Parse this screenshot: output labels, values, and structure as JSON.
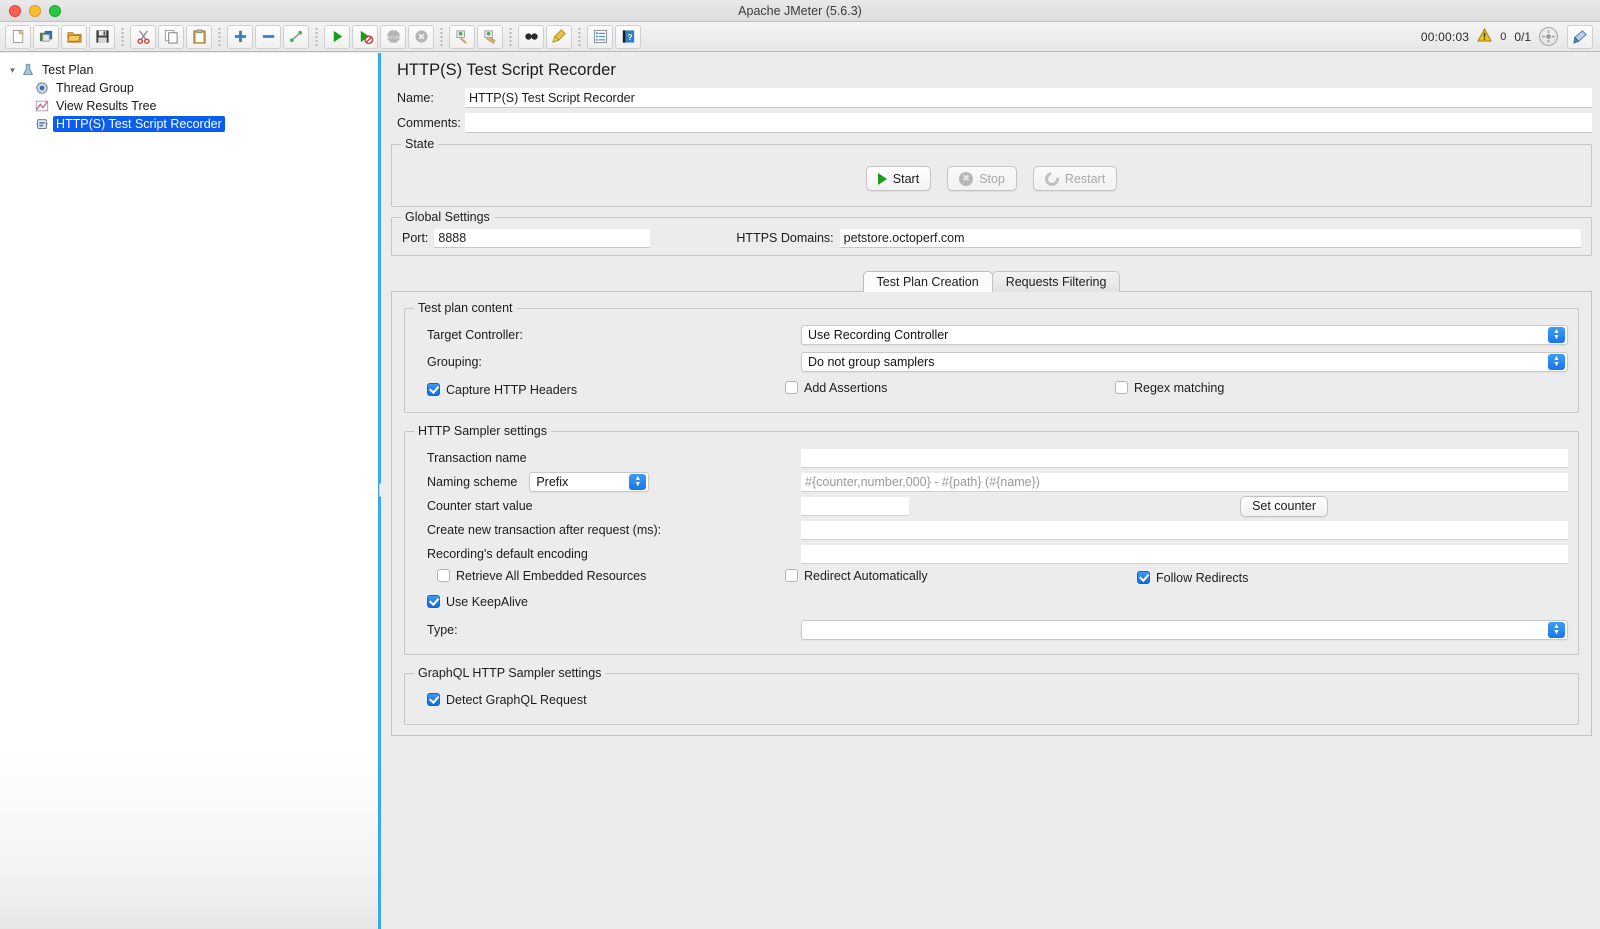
{
  "window": {
    "title": "Apache JMeter (5.6.3)"
  },
  "toolbar": {
    "buttons": [
      {
        "name": "new",
        "glyph": "📄"
      },
      {
        "name": "templates",
        "glyph": "📚"
      },
      {
        "name": "open",
        "glyph": "📂"
      },
      {
        "name": "save",
        "glyph": "💾"
      },
      {
        "name": "cut",
        "glyph": "✂"
      },
      {
        "name": "copy",
        "glyph": "❐"
      },
      {
        "name": "paste",
        "glyph": "📋"
      },
      {
        "name": "expand-all",
        "glyph": "➕"
      },
      {
        "name": "collapse-all",
        "glyph": "➖"
      },
      {
        "name": "toggle",
        "glyph": "↗"
      },
      {
        "name": "start",
        "glyph": "▶"
      },
      {
        "name": "start-no-timers",
        "glyph": "▷"
      },
      {
        "name": "stop",
        "glyph": "⬣"
      },
      {
        "name": "shutdown",
        "glyph": "✖"
      },
      {
        "name": "clear",
        "glyph": "🧹"
      },
      {
        "name": "clear-all",
        "glyph": "🧹"
      },
      {
        "name": "search",
        "glyph": "🔎"
      },
      {
        "name": "reset-search",
        "glyph": "🧹"
      },
      {
        "name": "function-helper",
        "glyph": "📑"
      },
      {
        "name": "help",
        "glyph": "❓"
      }
    ],
    "status": {
      "timer": "00:00:03",
      "warning_count": "0",
      "threads_ratio": "0/1"
    }
  },
  "tree": {
    "nodes": [
      {
        "label": "Test Plan",
        "icon": "test-plan-icon",
        "depth": 0,
        "expanded": true,
        "selected": false
      },
      {
        "label": "Thread Group",
        "icon": "thread-group-icon",
        "depth": 1,
        "expanded": false,
        "selected": false
      },
      {
        "label": "View Results Tree",
        "icon": "view-results-tree-icon",
        "depth": 1,
        "expanded": false,
        "selected": false
      },
      {
        "label": "HTTP(S) Test Script Recorder",
        "icon": "recorder-icon",
        "depth": 1,
        "expanded": false,
        "selected": true
      }
    ]
  },
  "panel": {
    "title": "HTTP(S) Test Script Recorder",
    "name_label": "Name:",
    "name_value": "HTTP(S) Test Script Recorder",
    "comments_label": "Comments:",
    "comments_value": ""
  },
  "state": {
    "legend": "State",
    "start_label": "Start",
    "stop_label": "Stop",
    "restart_label": "Restart",
    "start_enabled": true,
    "stop_enabled": false,
    "restart_enabled": false
  },
  "global_settings": {
    "legend": "Global Settings",
    "port_label": "Port:",
    "port_value": "8888",
    "https_domains_label": "HTTPS Domains:",
    "https_domains_value": "petstore.octoperf.com"
  },
  "tabs": {
    "items": [
      {
        "label": "Test Plan Creation",
        "active": true
      },
      {
        "label": "Requests Filtering",
        "active": false
      }
    ]
  },
  "test_plan_content": {
    "legend": "Test plan content",
    "target_controller_label": "Target Controller:",
    "target_controller_value": "Use Recording Controller",
    "grouping_label": "Grouping:",
    "grouping_value": "Do not group samplers",
    "capture_http_headers_label": "Capture HTTP Headers",
    "capture_http_headers_checked": true,
    "add_assertions_label": "Add Assertions",
    "add_assertions_checked": false,
    "regex_matching_label": "Regex matching",
    "regex_matching_checked": false
  },
  "http_sampler_settings": {
    "legend": "HTTP Sampler settings",
    "transaction_name_label": "Transaction name",
    "transaction_name_value": "",
    "naming_scheme_label": "Naming scheme",
    "naming_scheme_value": "Prefix",
    "naming_pattern_placeholder": "#{counter,number,000} - #{path} (#{name})",
    "counter_start_label": "Counter start value",
    "counter_start_value": "",
    "set_counter_label": "Set counter",
    "new_transaction_label": "Create new transaction after request (ms):",
    "new_transaction_value": "",
    "default_encoding_label": "Recording's default encoding",
    "default_encoding_value": "",
    "retrieve_embedded_label": "Retrieve All Embedded Resources",
    "retrieve_embedded_checked": false,
    "redirect_automatically_label": "Redirect Automatically",
    "redirect_automatically_checked": false,
    "follow_redirects_label": "Follow Redirects",
    "follow_redirects_checked": true,
    "use_keepalive_label": "Use KeepAlive",
    "use_keepalive_checked": true,
    "type_label": "Type:",
    "type_value": ""
  },
  "graphql_settings": {
    "legend": "GraphQL HTTP Sampler settings",
    "detect_graphql_label": "Detect GraphQL Request",
    "detect_graphql_checked": true
  }
}
